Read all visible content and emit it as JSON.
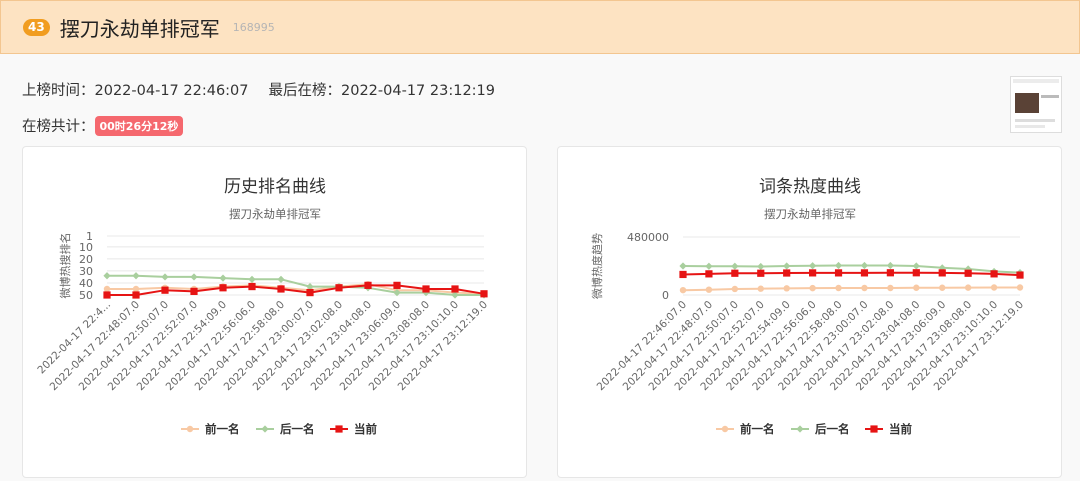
{
  "header": {
    "rank": "43",
    "title": "摆刀永劫单排冠军",
    "hot_value": "168995"
  },
  "info": {
    "onboard_label": "上榜时间：",
    "onboard_time": "2022-04-17 22:46:07",
    "last_label": "最后在榜：",
    "last_time": "2022-04-17 23:12:19",
    "total_label": "在榜共计：",
    "duration": "00时26分12秒"
  },
  "colors": {
    "prev": "#f8c9a4",
    "next": "#a9cf9e",
    "current": "#e61414",
    "header_bg": "#fde3c2",
    "rank_badge": "#f19d20",
    "duration_badge": "#f5686e"
  },
  "chart_data": [
    {
      "type": "line",
      "title": "历史排名曲线",
      "subtitle": "摆刀永劫单排冠军",
      "ylabel": "微博热搜排名",
      "y_inverse": true,
      "ylim": [
        1,
        50
      ],
      "yticks": [
        "1",
        "10",
        "20",
        "30",
        "40",
        "50"
      ],
      "x_labels": [
        "2022-04-17 22:4...",
        "2022-04-17 22:48:07.0",
        "2022-04-17 22:50:07.0",
        "2022-04-17 22:52:07.0",
        "2022-04-17 22:54:09.0",
        "2022-04-17 22:56:06.0",
        "2022-04-17 22:58:08.0",
        "2022-04-17 23:00:07.0",
        "2022-04-17 23:02:08.0",
        "2022-04-17 23:04:08.0",
        "2022-04-17 23:06:09.0",
        "2022-04-17 23:08:08.0",
        "2022-04-17 23:10:10.0",
        "2022-04-17 23:12:19.0"
      ],
      "series": [
        {
          "name": "前一名",
          "values": [
            45,
            45,
            44,
            45,
            43,
            42,
            44,
            46,
            43,
            41,
            46,
            46,
            48,
            49
          ]
        },
        {
          "name": "后一名",
          "values": [
            34,
            34,
            35,
            35,
            36,
            37,
            37,
            43,
            43,
            44,
            48,
            48,
            50,
            50
          ]
        },
        {
          "name": "当前",
          "values": [
            50,
            50,
            46,
            47,
            44,
            43,
            45,
            48,
            44,
            42,
            42,
            45,
            45,
            49
          ]
        }
      ],
      "legend_position": "bottom"
    },
    {
      "type": "line",
      "title": "词条热度曲线",
      "subtitle": "摆刀永劫单排冠军",
      "ylabel": "微博热度趋势",
      "ylim": [
        0,
        480000
      ],
      "yticks": [
        "480000",
        "0"
      ],
      "x_labels": [
        "2022-04-17 22:46:07.0",
        "2022-04-17 22:48:07.0",
        "2022-04-17 22:50:07.0",
        "2022-04-17 22:52:07.0",
        "2022-04-17 22:54:09.0",
        "2022-04-17 22:56:06.0",
        "2022-04-17 22:58:08.0",
        "2022-04-17 23:00:07.0",
        "2022-04-17 23:02:08.0",
        "2022-04-17 23:04:08.0",
        "2022-04-17 23:06:09.0",
        "2022-04-17 23:08:08.0",
        "2022-04-17 23:10:10.0",
        "2022-04-17 23:12:19.0"
      ],
      "series": [
        {
          "name": "前一名",
          "values": [
            40000,
            44000,
            50000,
            52000,
            55000,
            57000,
            58000,
            58000,
            58000,
            60000,
            60000,
            61000,
            62000,
            62000
          ]
        },
        {
          "name": "后一名",
          "values": [
            240000,
            238000,
            238000,
            236000,
            240000,
            242000,
            244000,
            244000,
            244000,
            240000,
            225000,
            215000,
            195000,
            185000
          ]
        },
        {
          "name": "当前",
          "values": [
            170000,
            175000,
            180000,
            180000,
            182000,
            183000,
            183000,
            183000,
            184000,
            184000,
            183000,
            180000,
            175000,
            165000
          ]
        }
      ],
      "legend_position": "bottom"
    }
  ]
}
